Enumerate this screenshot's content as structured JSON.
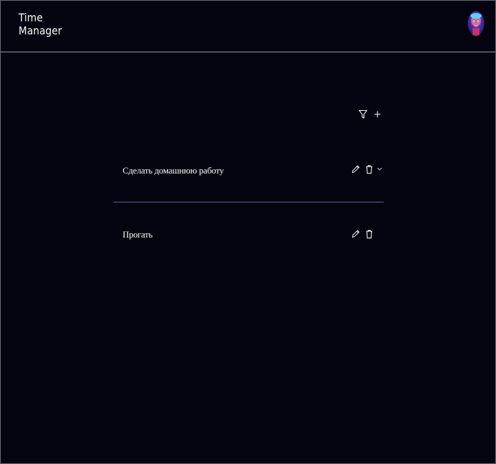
{
  "app": {
    "logo_line1": "Time",
    "logo_line2": "Manager"
  },
  "header": {
    "avatar_icon": "user-avatar"
  },
  "toolbar": {
    "filter_icon": "filter-icon",
    "add_icon": "plus-icon"
  },
  "tasks": [
    {
      "title": "Сделать домашнюю работу",
      "actions": [
        "pencil-icon",
        "trash-icon",
        "chevron-down-icon"
      ]
    },
    {
      "title": "Прогать",
      "actions": [
        "pencil-icon",
        "trash-icon"
      ]
    }
  ],
  "colors": {
    "background": "#03040f",
    "divider": "#9a9ca6",
    "task_separator": "#4c7194",
    "text": "#ffffff"
  }
}
